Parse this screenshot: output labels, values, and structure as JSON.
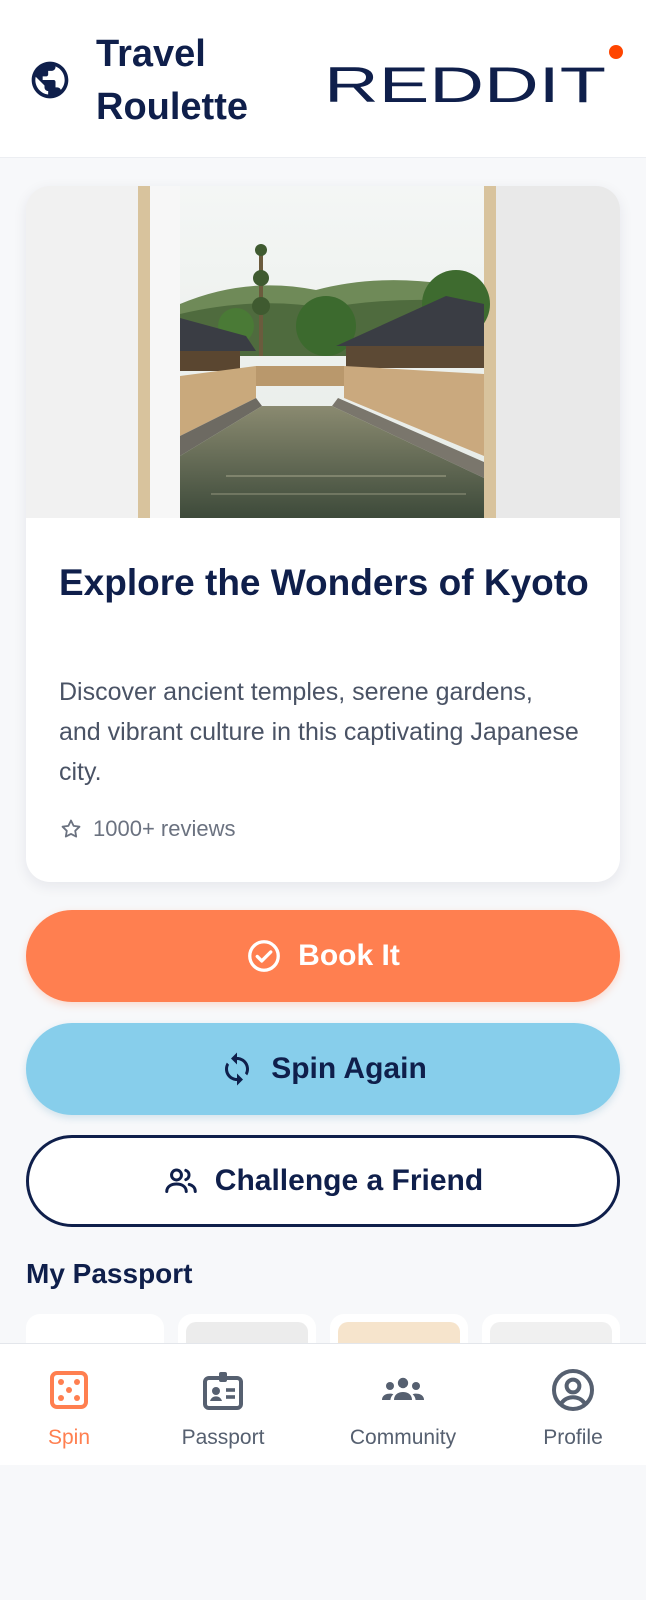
{
  "header": {
    "title": "Travel Roulette",
    "brand": "REDDIT"
  },
  "destination": {
    "title": "Explore the Wonders of Kyoto",
    "description": "Discover ancient temples, serene gardens, and vibrant culture in this captivating Japanese city.",
    "reviews": "1000+ reviews",
    "image_icon": "kyoto-canal-photo"
  },
  "actions": {
    "book_label": "Book It",
    "spin_label": "Spin Again",
    "challenge_label": "Challenge a Friend"
  },
  "passport": {
    "title": "My Passport"
  },
  "nav": {
    "items": [
      {
        "label": "Spin",
        "icon": "dice-icon",
        "active": true
      },
      {
        "label": "Passport",
        "icon": "id-badge-icon",
        "active": false
      },
      {
        "label": "Community",
        "icon": "group-icon",
        "active": false
      },
      {
        "label": "Profile",
        "icon": "account-circle-icon",
        "active": false
      }
    ]
  },
  "colors": {
    "navy": "#0f1f4b",
    "accent": "#ff7f50",
    "sky": "#87ceeb",
    "brand_dot": "#ff4500"
  }
}
